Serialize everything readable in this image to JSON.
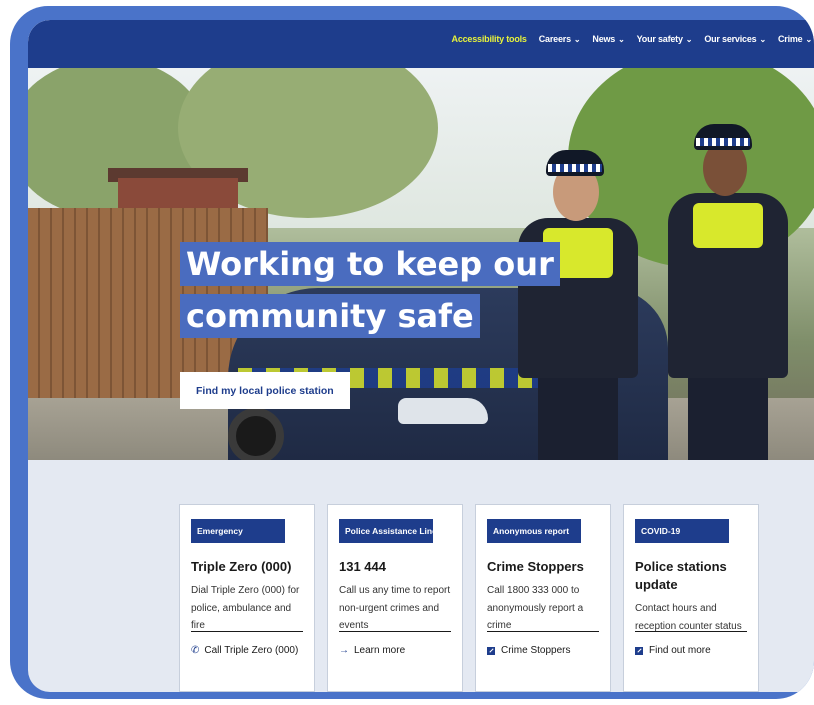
{
  "nav": {
    "items": [
      {
        "label": "Accessibility tools",
        "dropdown": false,
        "accent": true
      },
      {
        "label": "Careers",
        "dropdown": true
      },
      {
        "label": "News",
        "dropdown": true
      },
      {
        "label": "Your safety",
        "dropdown": true
      },
      {
        "label": "Our services",
        "dropdown": true
      },
      {
        "label": "Crime",
        "dropdown": true
      }
    ],
    "chevron": "⌄"
  },
  "hero": {
    "headline_line1": "Working to keep our",
    "headline_line2": "community safe",
    "cta_label": "Find my local police station"
  },
  "cards": [
    {
      "badge": "Emergency",
      "title": "Triple Zero (000)",
      "text": "Dial Triple Zero (000) for police, ambulance and fire",
      "link_label": "Call Triple Zero (000)",
      "link_icon": "phone-icon",
      "link_glyph": "📞"
    },
    {
      "badge": "Police Assistance Line",
      "title": "131 444",
      "text": "Call us any time to report non-urgent crimes and events",
      "link_label": "Learn more",
      "link_icon": "arrow-right-icon",
      "link_glyph": "→"
    },
    {
      "badge": "Anonymous report",
      "title": "Crime Stoppers",
      "text": "Call 1800 333 000 to anonymously report a crime",
      "link_label": "Crime Stoppers",
      "link_icon": "external-link-icon",
      "link_glyph": ""
    },
    {
      "badge": "COVID-19",
      "title": "Police stations update",
      "text": "Contact hours and reception counter status",
      "link_label": "Find out more",
      "link_icon": "external-link-icon",
      "link_glyph": ""
    }
  ],
  "colors": {
    "frame": "#4a73c9",
    "nav": "#1e3d8c",
    "accent": "#e7f23b",
    "headline_bg": "#4a6cbf",
    "badge": "#1e3d8c"
  }
}
